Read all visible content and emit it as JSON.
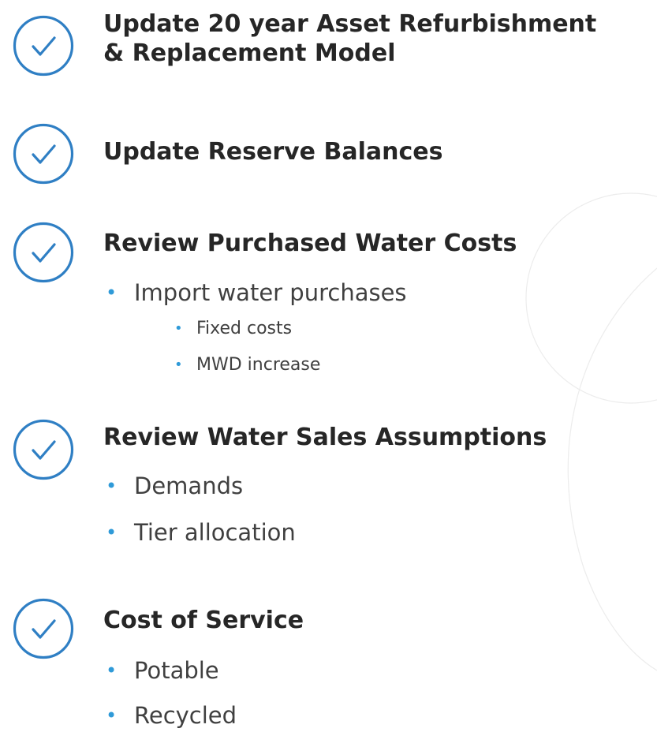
{
  "colors": {
    "accent": "#2f7fc4",
    "bullet": "#2f9ad8",
    "heading_text": "#262626",
    "body_text": "#404040"
  },
  "sections": [
    {
      "heading": "Update 20 year Asset Refurbishment & Replacement Model",
      "heading_lines": [
        "Update 20 year Asset Refurbishment",
        "& Replacement Model"
      ],
      "icon": "checkmark-circle-icon",
      "items": []
    },
    {
      "heading": "Update Reserve Balances",
      "icon": "checkmark-circle-icon",
      "items": []
    },
    {
      "heading": "Review Purchased Water Costs",
      "icon": "checkmark-circle-icon",
      "items": [
        {
          "text": "Import water purchases",
          "subitems": [
            "Fixed costs",
            "MWD increase"
          ]
        }
      ]
    },
    {
      "heading": "Review Water Sales Assumptions",
      "icon": "checkmark-circle-icon",
      "items": [
        {
          "text": "Demands"
        },
        {
          "text": "Tier allocation"
        }
      ]
    },
    {
      "heading": "Cost of Service",
      "icon": "checkmark-circle-icon",
      "items": [
        {
          "text": "Potable"
        },
        {
          "text": "Recycled"
        }
      ]
    }
  ],
  "bullet_glyph": "•"
}
